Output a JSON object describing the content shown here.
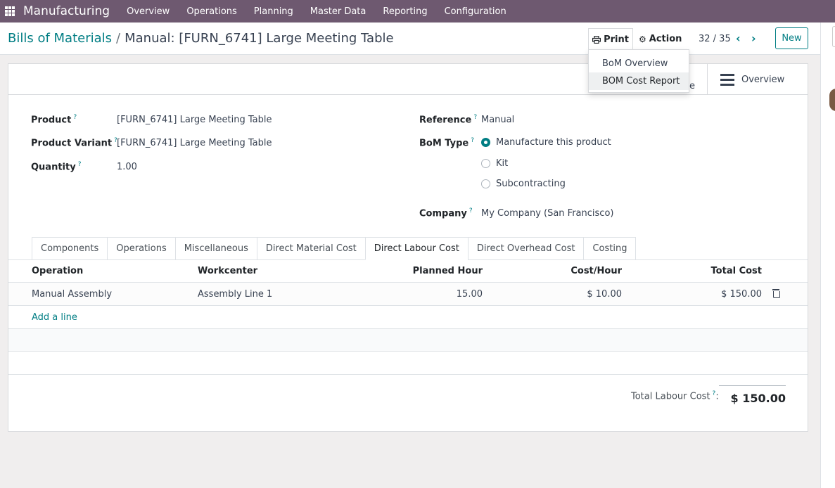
{
  "navbar": {
    "app_name": "Manufacturing",
    "menu": [
      "Overview",
      "Operations",
      "Planning",
      "Master Data",
      "Reporting",
      "Configuration"
    ]
  },
  "breadcrumb": {
    "parent": "Bills of Materials",
    "separator": "/",
    "current": "Manual: [FURN_6741] Large Meeting Table"
  },
  "toolbar": {
    "print_label": "Print",
    "action_label": "Action",
    "pager": "32 / 35",
    "new_label": "New"
  },
  "print_menu": {
    "items": [
      "BoM Overview",
      "BOM Cost Report"
    ]
  },
  "button_box": {
    "overview_label": "Overview",
    "partial_text": "e"
  },
  "form": {
    "product_label": "Product",
    "product_value": "[FURN_6741] Large Meeting Table",
    "variant_label": "Product Variant",
    "variant_value": "[FURN_6741] Large Meeting Table",
    "quantity_label": "Quantity",
    "quantity_value": "1.00",
    "reference_label": "Reference",
    "reference_value": "Manual",
    "bom_type_label": "BoM Type",
    "bom_type_options": [
      "Manufacture this product",
      "Kit",
      "Subcontracting"
    ],
    "bom_type_selected": "Manufacture this product",
    "company_label": "Company",
    "company_value": "My Company (San Francisco)",
    "help_mark": "?"
  },
  "tabs": [
    "Components",
    "Operations",
    "Miscellaneous",
    "Direct Material Cost",
    "Direct Labour Cost",
    "Direct Overhead Cost",
    "Costing"
  ],
  "active_tab": "Direct Labour Cost",
  "table": {
    "headers": [
      "Operation",
      "Workcenter",
      "Planned Hour",
      "Cost/Hour",
      "Total Cost"
    ],
    "rows": [
      [
        "Manual Assembly",
        "Assembly Line 1",
        "15.00",
        "$ 10.00",
        "$ 150.00"
      ]
    ],
    "add_line": "Add a line"
  },
  "totals": {
    "label": "Total Labour Cost",
    "colon": ":",
    "value": "$ 150.00"
  },
  "colors": {
    "navbar": "#6e5970",
    "accent": "#017e84"
  }
}
